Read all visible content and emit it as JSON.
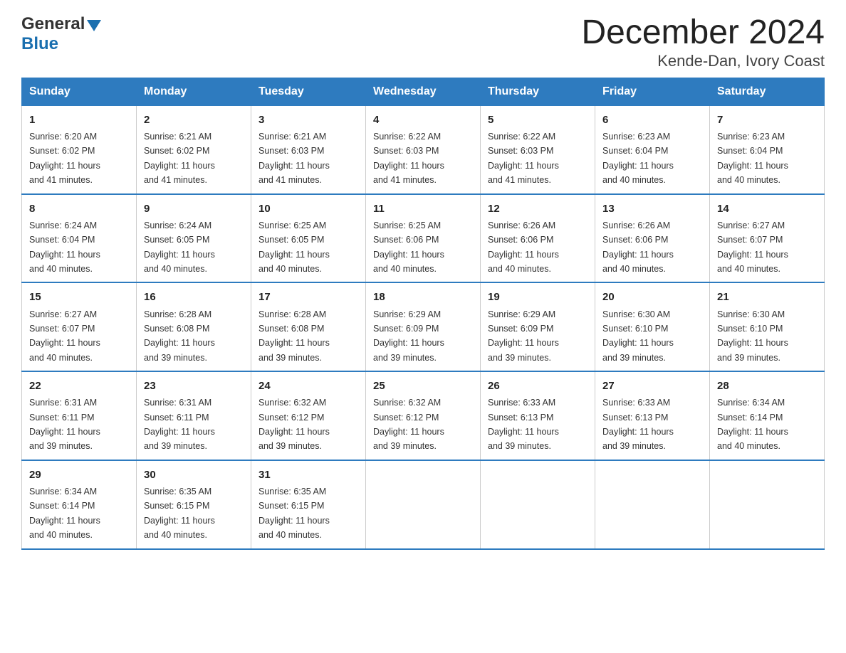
{
  "header": {
    "logo_general": "General",
    "logo_blue": "Blue",
    "title": "December 2024",
    "subtitle": "Kende-Dan, Ivory Coast"
  },
  "days_of_week": [
    "Sunday",
    "Monday",
    "Tuesday",
    "Wednesday",
    "Thursday",
    "Friday",
    "Saturday"
  ],
  "weeks": [
    [
      {
        "day": "1",
        "sunrise": "6:20 AM",
        "sunset": "6:02 PM",
        "daylight": "11 hours and 41 minutes."
      },
      {
        "day": "2",
        "sunrise": "6:21 AM",
        "sunset": "6:02 PM",
        "daylight": "11 hours and 41 minutes."
      },
      {
        "day": "3",
        "sunrise": "6:21 AM",
        "sunset": "6:03 PM",
        "daylight": "11 hours and 41 minutes."
      },
      {
        "day": "4",
        "sunrise": "6:22 AM",
        "sunset": "6:03 PM",
        "daylight": "11 hours and 41 minutes."
      },
      {
        "day": "5",
        "sunrise": "6:22 AM",
        "sunset": "6:03 PM",
        "daylight": "11 hours and 41 minutes."
      },
      {
        "day": "6",
        "sunrise": "6:23 AM",
        "sunset": "6:04 PM",
        "daylight": "11 hours and 40 minutes."
      },
      {
        "day": "7",
        "sunrise": "6:23 AM",
        "sunset": "6:04 PM",
        "daylight": "11 hours and 40 minutes."
      }
    ],
    [
      {
        "day": "8",
        "sunrise": "6:24 AM",
        "sunset": "6:04 PM",
        "daylight": "11 hours and 40 minutes."
      },
      {
        "day": "9",
        "sunrise": "6:24 AM",
        "sunset": "6:05 PM",
        "daylight": "11 hours and 40 minutes."
      },
      {
        "day": "10",
        "sunrise": "6:25 AM",
        "sunset": "6:05 PM",
        "daylight": "11 hours and 40 minutes."
      },
      {
        "day": "11",
        "sunrise": "6:25 AM",
        "sunset": "6:06 PM",
        "daylight": "11 hours and 40 minutes."
      },
      {
        "day": "12",
        "sunrise": "6:26 AM",
        "sunset": "6:06 PM",
        "daylight": "11 hours and 40 minutes."
      },
      {
        "day": "13",
        "sunrise": "6:26 AM",
        "sunset": "6:06 PM",
        "daylight": "11 hours and 40 minutes."
      },
      {
        "day": "14",
        "sunrise": "6:27 AM",
        "sunset": "6:07 PM",
        "daylight": "11 hours and 40 minutes."
      }
    ],
    [
      {
        "day": "15",
        "sunrise": "6:27 AM",
        "sunset": "6:07 PM",
        "daylight": "11 hours and 40 minutes."
      },
      {
        "day": "16",
        "sunrise": "6:28 AM",
        "sunset": "6:08 PM",
        "daylight": "11 hours and 39 minutes."
      },
      {
        "day": "17",
        "sunrise": "6:28 AM",
        "sunset": "6:08 PM",
        "daylight": "11 hours and 39 minutes."
      },
      {
        "day": "18",
        "sunrise": "6:29 AM",
        "sunset": "6:09 PM",
        "daylight": "11 hours and 39 minutes."
      },
      {
        "day": "19",
        "sunrise": "6:29 AM",
        "sunset": "6:09 PM",
        "daylight": "11 hours and 39 minutes."
      },
      {
        "day": "20",
        "sunrise": "6:30 AM",
        "sunset": "6:10 PM",
        "daylight": "11 hours and 39 minutes."
      },
      {
        "day": "21",
        "sunrise": "6:30 AM",
        "sunset": "6:10 PM",
        "daylight": "11 hours and 39 minutes."
      }
    ],
    [
      {
        "day": "22",
        "sunrise": "6:31 AM",
        "sunset": "6:11 PM",
        "daylight": "11 hours and 39 minutes."
      },
      {
        "day": "23",
        "sunrise": "6:31 AM",
        "sunset": "6:11 PM",
        "daylight": "11 hours and 39 minutes."
      },
      {
        "day": "24",
        "sunrise": "6:32 AM",
        "sunset": "6:12 PM",
        "daylight": "11 hours and 39 minutes."
      },
      {
        "day": "25",
        "sunrise": "6:32 AM",
        "sunset": "6:12 PM",
        "daylight": "11 hours and 39 minutes."
      },
      {
        "day": "26",
        "sunrise": "6:33 AM",
        "sunset": "6:13 PM",
        "daylight": "11 hours and 39 minutes."
      },
      {
        "day": "27",
        "sunrise": "6:33 AM",
        "sunset": "6:13 PM",
        "daylight": "11 hours and 39 minutes."
      },
      {
        "day": "28",
        "sunrise": "6:34 AM",
        "sunset": "6:14 PM",
        "daylight": "11 hours and 40 minutes."
      }
    ],
    [
      {
        "day": "29",
        "sunrise": "6:34 AM",
        "sunset": "6:14 PM",
        "daylight": "11 hours and 40 minutes."
      },
      {
        "day": "30",
        "sunrise": "6:35 AM",
        "sunset": "6:15 PM",
        "daylight": "11 hours and 40 minutes."
      },
      {
        "day": "31",
        "sunrise": "6:35 AM",
        "sunset": "6:15 PM",
        "daylight": "11 hours and 40 minutes."
      },
      null,
      null,
      null,
      null
    ]
  ],
  "labels": {
    "sunrise": "Sunrise:",
    "sunset": "Sunset:",
    "daylight": "Daylight:"
  }
}
